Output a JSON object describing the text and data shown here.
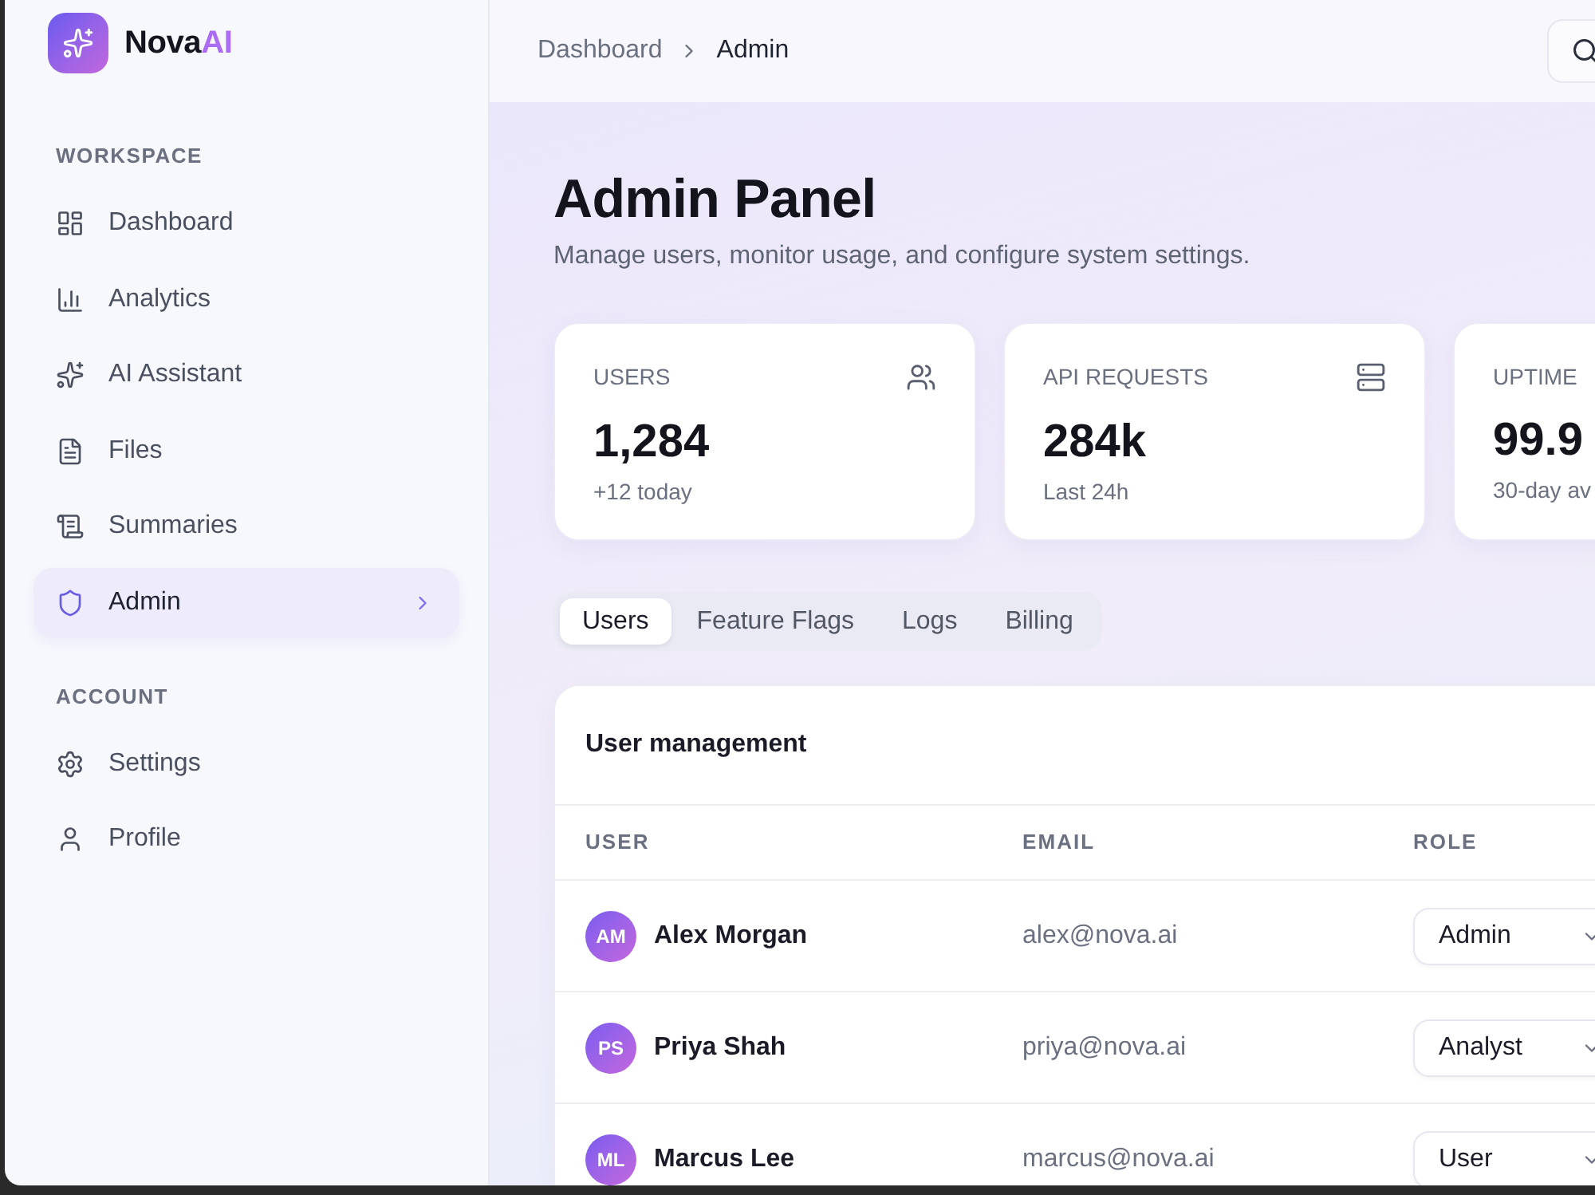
{
  "brand": {
    "name": "Nova",
    "accent": "AI"
  },
  "sidebar": {
    "sections": [
      {
        "title": "WORKSPACE",
        "items": [
          {
            "label": "Dashboard",
            "selected": false
          },
          {
            "label": "Analytics",
            "selected": false
          },
          {
            "label": "AI Assistant",
            "selected": false
          },
          {
            "label": "Files",
            "selected": false
          },
          {
            "label": "Summaries",
            "selected": false
          },
          {
            "label": "Admin",
            "selected": true
          }
        ]
      },
      {
        "title": "ACCOUNT",
        "items": [
          {
            "label": "Settings",
            "selected": false
          },
          {
            "label": "Profile",
            "selected": false
          }
        ]
      }
    ]
  },
  "breadcrumb": [
    {
      "label": "Dashboard",
      "current": false
    },
    {
      "label": "Admin",
      "current": true
    }
  ],
  "page": {
    "title": "Admin Panel",
    "subtitle": "Manage users, monitor usage, and configure system settings."
  },
  "stats": [
    {
      "label": "USERS",
      "value": "1,284",
      "note": "+12 today"
    },
    {
      "label": "API REQUESTS",
      "value": "284k",
      "note": "Last 24h"
    },
    {
      "label": "UPTIME",
      "value": "99.9",
      "note": "30-day av"
    }
  ],
  "tabs": [
    {
      "label": "Users",
      "selected": true
    },
    {
      "label": "Feature Flags",
      "selected": false
    },
    {
      "label": "Logs",
      "selected": false
    },
    {
      "label": "Billing",
      "selected": false
    }
  ],
  "user_table": {
    "title": "User management",
    "columns": [
      "USER",
      "EMAIL",
      "ROLE"
    ],
    "rows": [
      {
        "initials": "AM",
        "name": "Alex Morgan",
        "email": "alex@nova.ai",
        "role": "Admin"
      },
      {
        "initials": "PS",
        "name": "Priya Shah",
        "email": "priya@nova.ai",
        "role": "Analyst"
      },
      {
        "initials": "ML",
        "name": "Marcus Lee",
        "email": "marcus@nova.ai",
        "role": "User"
      }
    ]
  }
}
